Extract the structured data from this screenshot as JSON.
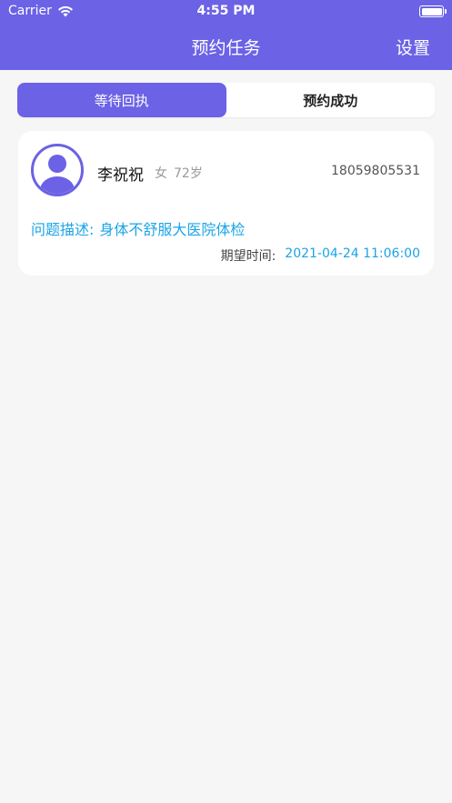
{
  "status_bar": {
    "carrier": "Carrier",
    "time": "4:55 PM"
  },
  "nav": {
    "title": "预约任务",
    "settings": "设置"
  },
  "tabs": [
    {
      "label": "等待回执",
      "active": true
    },
    {
      "label": "预约成功",
      "active": false
    }
  ],
  "card": {
    "name": "李祝祝",
    "gender": "女",
    "age": "72岁",
    "phone": "18059805531",
    "desc_label": "问题描述:",
    "desc_value": "身体不舒服大医院体检",
    "expect_label": "期望时间:",
    "expect_value": "2021-04-24 11:06:00"
  },
  "colors": {
    "accent": "#6b62e6",
    "link": "#1aa4e6",
    "background": "#f6f6f6"
  }
}
